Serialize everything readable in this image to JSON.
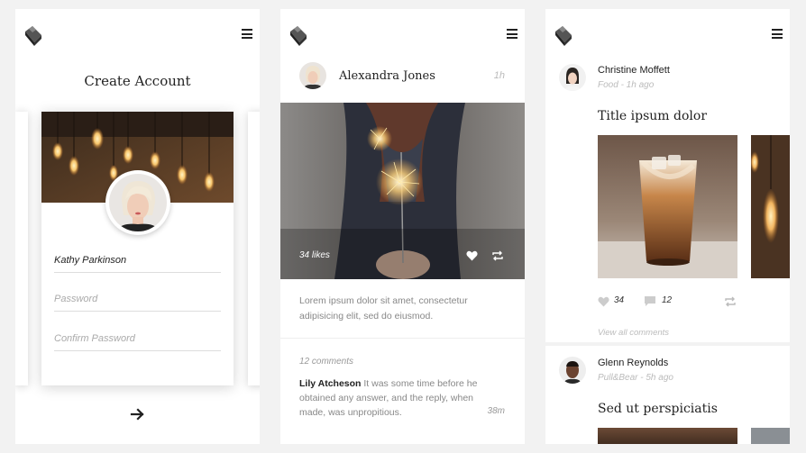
{
  "screen1": {
    "title": "Create Account",
    "name_value": "Kathy Parkinson",
    "password_placeholder": "Password",
    "confirm_placeholder": "Confirm Password"
  },
  "screen2": {
    "author": "Alexandra Jones",
    "time": "1h",
    "likes": "34 likes",
    "body": "Lorem ipsum dolor sit amet, consectetur adipisicing elit, sed do eiusmod.",
    "comments_count": "12 comments",
    "comment": {
      "author": "Lily Atcheson",
      "text": " It was some time before he obtained any answer, and the reply, when made, was unpropitious.",
      "time": "38m"
    }
  },
  "screen3": {
    "post1": {
      "author": "Christine Moffett",
      "meta": "Food - 1h ago",
      "title": "Title ipsum dolor",
      "likes": "34",
      "comments": "12",
      "view_all": "View all comments"
    },
    "post2": {
      "author": "Glenn Reynolds",
      "meta": "Pull&Bear - 5h ago",
      "title": "Sed ut perspiciatis"
    }
  },
  "icons": {
    "logo": "cube-logo-icon",
    "menu": "hamburger-menu-icon",
    "next": "arrow-right-icon",
    "like": "heart-icon",
    "repost": "repost-icon",
    "comment": "comment-icon"
  },
  "colors": {
    "background": "#f2f2f2",
    "card": "#ffffff",
    "text": "#222222",
    "muted": "#999999"
  }
}
